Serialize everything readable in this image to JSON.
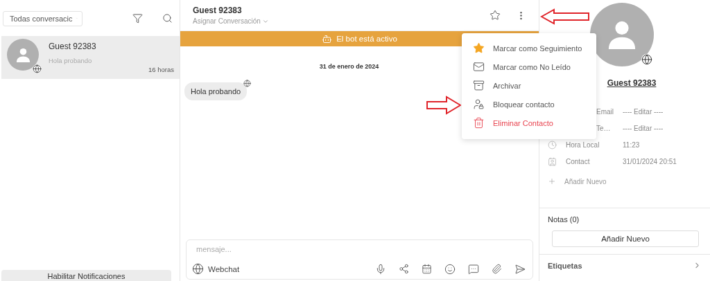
{
  "sidebar": {
    "filter": {
      "value": "Todas conversacic"
    },
    "conversations": [
      {
        "name": "Guest 92383",
        "preview": "Hola probando",
        "time": "16 horas",
        "selected": true
      }
    ],
    "notifications_button": "Habilitar Notificaciones"
  },
  "chat": {
    "title": "Guest 92383",
    "assign": "Asignar Conversación",
    "banner": "El bot está activo",
    "date": "31 de enero de 2024",
    "messages": [
      {
        "text": "Hola probando"
      }
    ],
    "composer": {
      "placeholder": "mensaje...",
      "channel": "Webchat"
    }
  },
  "menu": {
    "items": [
      {
        "kind": "star",
        "label": "Marcar como Seguimiento",
        "danger": false
      },
      {
        "kind": "mail",
        "label": "Marcar como No Leído",
        "danger": false
      },
      {
        "kind": "archive",
        "label": "Archivar",
        "danger": false
      },
      {
        "kind": "block",
        "label": "Bloquear contacto",
        "danger": false
      },
      {
        "kind": "trash",
        "label": "Eliminar Contacto",
        "danger": true
      }
    ]
  },
  "contact": {
    "name": "Guest 92383",
    "details": [
      {
        "kind": "email",
        "label": "Email",
        "value": "---- Editar ----",
        "covered": true
      },
      {
        "kind": "phone",
        "label": "Te…",
        "value": "---- Editar ----",
        "covered": true
      },
      {
        "kind": "clock",
        "label": "Hora Local",
        "value": "11:23",
        "covered": false
      },
      {
        "kind": "card",
        "label": "Contact",
        "value": "31/01/2024 20:51",
        "covered": false
      }
    ],
    "add_field": "Añadir Nuevo",
    "notes_title": "Notas (0)",
    "notes_button": "Añadir Nuevo",
    "tags_title": "Etiquetas"
  }
}
